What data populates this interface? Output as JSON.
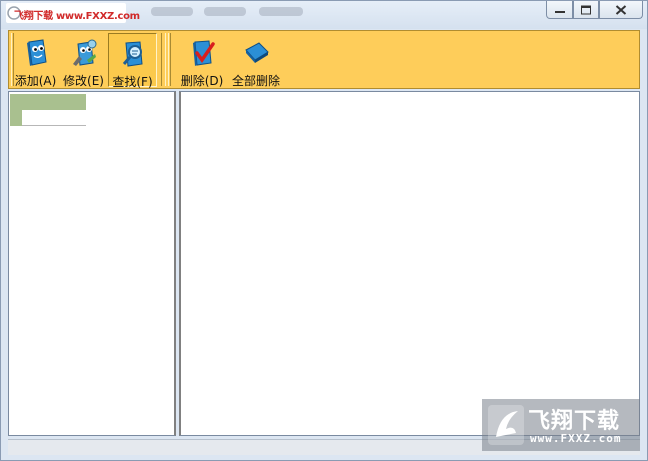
{
  "window": {
    "watermark_text": "飞翔下载 www.FXXZ.com"
  },
  "toolbar": {
    "buttons": [
      {
        "label": "添加(A)",
        "icon": "book-add-icon"
      },
      {
        "label": "修改(E)",
        "icon": "book-edit-icon"
      },
      {
        "label": "查找(F)",
        "icon": "book-search-icon"
      },
      {
        "label": "删除(D)",
        "icon": "book-delete-icon"
      },
      {
        "label": "全部删除",
        "icon": "book-delete-all-icon"
      }
    ]
  },
  "watermark": {
    "brand": "飞翔下载",
    "url": "www.FXXZ.com"
  },
  "colors": {
    "toolbar_bg": "#fecd5a",
    "tree_highlight": "#a9c08f",
    "icon_blue": "#2b8fd6"
  }
}
